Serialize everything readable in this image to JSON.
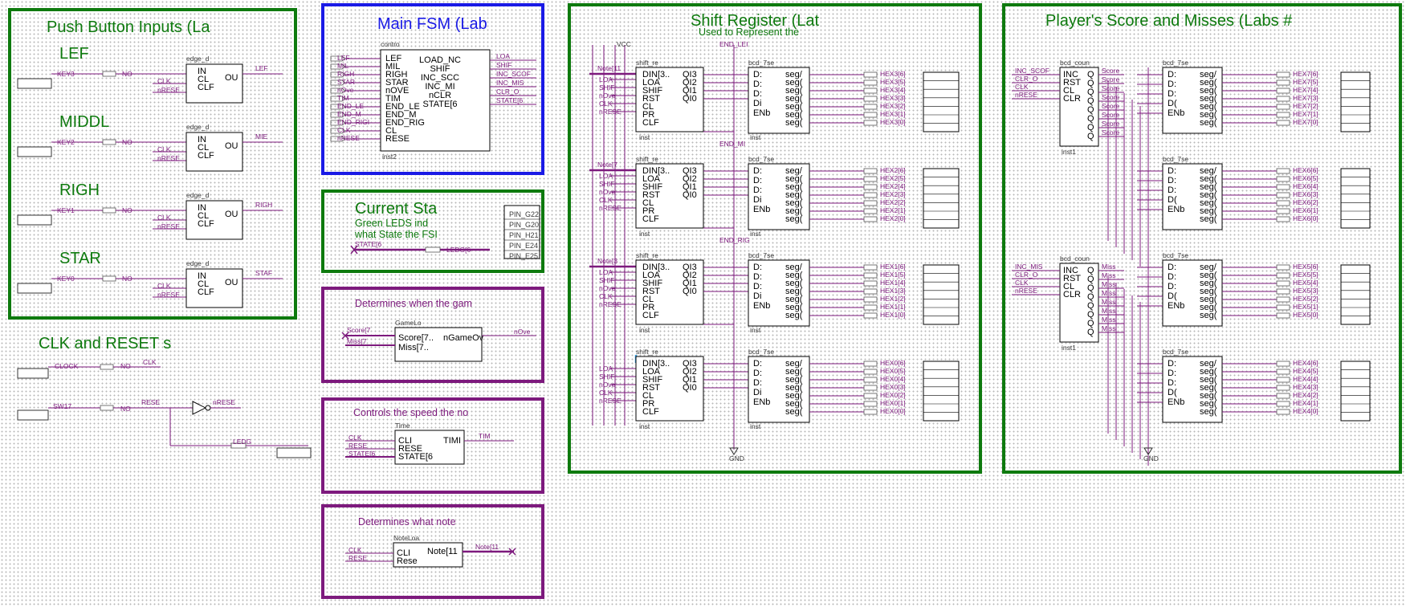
{
  "colors": {
    "green": "#0e7a0e",
    "blue": "#1a1ae6",
    "purple": "#7d1a7d",
    "wire": "#7d1a7d",
    "hex_wire": "#7d1a7d"
  },
  "sections": {
    "push_buttons": {
      "title": "Push Button Inputs (La",
      "groups": [
        {
          "label": "LEF",
          "key": "KEY3",
          "out": "LEF"
        },
        {
          "label": "MIDDL",
          "key": "KEY2",
          "out": "MIE"
        },
        {
          "label": "RIGH",
          "key": "KEY1",
          "out": "RIGH"
        },
        {
          "label": "STAR",
          "key": "KEY0",
          "out": "STAF"
        }
      ],
      "block_name": "edge_d",
      "ports": [
        "IN",
        "CL",
        "CLF"
      ],
      "out_port": "OU",
      "clk_sig": "CLK",
      "reset_sig": "nRESE",
      "not_label": "NO"
    },
    "clk_reset": {
      "title": "CLK and RESET s",
      "clock": "CLOCK",
      "clk_out": "CLK",
      "sw": "SW17",
      "reset": "RESE",
      "nreset": "nRESE",
      "out": "LEDG",
      "not_label": "NO"
    },
    "main_fsm": {
      "title": "Main FSM (Lab",
      "block_name": "contro",
      "inputs": [
        "LEF",
        "MIL",
        "RIGH",
        "STAR",
        "nOVE",
        "TIM",
        "END_LE",
        "END_M",
        "END_RIG",
        "CL",
        "RESE"
      ],
      "left_sigs": [
        "LEF",
        "MIL",
        "RIGH",
        "STAR",
        "nOve",
        "TIM",
        "END_LE",
        "END_M",
        "END_RIGI",
        "CLK",
        "nRESE"
      ],
      "outputs": [
        "LOAD_NC",
        "SHIF",
        "INC_SCC",
        "INC_MI",
        "nCLR",
        "STATE[6"
      ],
      "right_sigs": [
        "LOA",
        "SHIF",
        "INC_SCOF",
        "INC_MIS",
        "CLR_O",
        "STATE[6"
      ],
      "inst": "inst2"
    },
    "current_state": {
      "title": "Current Sta",
      "line1": "Green LEDS ind",
      "line2": "what State the FSI",
      "pins": [
        "PIN_G22",
        "PIN_G20",
        "PIN_H21",
        "PIN_E24",
        "PIN_E25"
      ],
      "in_sig": "STATE[6",
      "out_sig": "LEDG[6"
    },
    "game_over": {
      "title": "Determines when the gam",
      "block_name": "GameLo",
      "in1": "Score[7..",
      "in2": "Miss[7..",
      "out": "nGameOv",
      "out_sig": "nOve",
      "left1": "Score[7",
      "left2": "Miss[7"
    },
    "speed": {
      "title": "Controls the speed the no",
      "block_name": "Time",
      "ports": [
        "CLI",
        "RESE",
        "STATE[6"
      ],
      "left_sigs": [
        "CLK",
        "RESE",
        "STATE[6"
      ],
      "out": "TIMI",
      "out_sig": "TIM"
    },
    "note": {
      "title": "Determines what note",
      "block_name": "NoteLoa",
      "ports": [
        "CLI",
        "Rese"
      ],
      "left_sigs": [
        "CLK",
        "RESE"
      ],
      "out": "Note[11",
      "out_sig": "Note[11"
    },
    "shift_register": {
      "title": "Shift Register (Lat",
      "subtitle": "Used to Represent the",
      "sr_name": "shift_re",
      "sr_ports": [
        "DIN[3..",
        "LOA",
        "SHIF",
        "RST",
        "CL",
        "PR",
        "CLF"
      ],
      "sr_outs": [
        "QI3",
        "QI2",
        "QI1",
        "QI0"
      ],
      "bcd_name": "bcd_7se",
      "bcd_ports": [
        "D:",
        "D:",
        "D:",
        "Di",
        "ENb"
      ],
      "seg_ports": [
        "seg/",
        "seg(",
        "seg(",
        "seg(",
        "seg(",
        "seg(",
        "seg("
      ],
      "rows": [
        {
          "note": "Note[11",
          "end": "END_LEI",
          "hex": "HEX3",
          "inst": "inst",
          "bcd_inst": "inst"
        },
        {
          "note": "Note[7",
          "end": "END_MI",
          "hex": "HEX2",
          "inst": "inst",
          "bcd_inst": "inst"
        },
        {
          "note": "Note[3",
          "end": "END_RIG",
          "hex": "HEX1",
          "inst": "inst",
          "bcd_inst": "inst"
        },
        {
          "note": "",
          "end": "",
          "hex": "HEX0",
          "inst": "inst",
          "bcd_inst": "inst"
        }
      ],
      "left_sigs": [
        "LOA",
        "SHIF",
        "nOve",
        "CLK",
        "nRESE"
      ],
      "gnd": "GND",
      "vcc": "VCC"
    },
    "score": {
      "title": "Player's Score and Misses (Labs #",
      "counter_name": "bcd_coun",
      "counter_ports": [
        "INC",
        "RST",
        "CL",
        "CLR"
      ],
      "counter_outs": [
        "Q",
        "Q",
        "Q",
        "Q",
        "Q",
        "Q",
        "Q",
        "Q"
      ],
      "top_counter_in": [
        "INC_SCOF",
        "CLR_O",
        "CLK",
        "nRESE"
      ],
      "bot_counter_in": [
        "INC_MIS",
        "CLR_O",
        "CLK",
        "nRESE"
      ],
      "top_sigs": [
        "Score",
        "Score",
        "Score",
        "Score",
        "Score",
        "Score",
        "Score",
        "Score"
      ],
      "bot_sigs": [
        "Miss",
        "Miss",
        "Miss",
        "Miss",
        "Miss",
        "Miss",
        "Miss",
        "Miss"
      ],
      "bcd_name": "bcd_7se",
      "bcd_ports": [
        "D:",
        "D:",
        "D:",
        "D(",
        "ENb"
      ],
      "rows": [
        {
          "hex": "HEX7"
        },
        {
          "hex": "HEX6"
        },
        {
          "hex": "HEX5"
        },
        {
          "hex": "HEX4"
        }
      ],
      "gnd": "GND"
    }
  }
}
